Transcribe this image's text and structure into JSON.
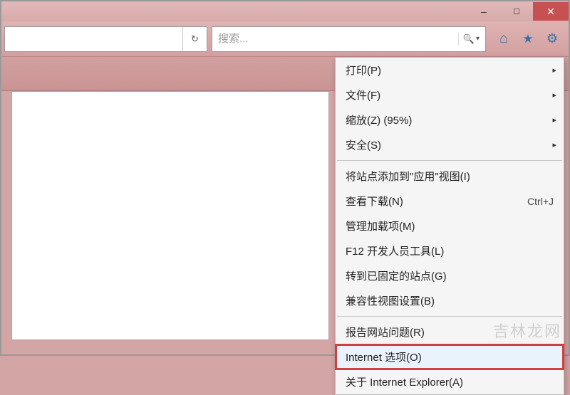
{
  "window": {
    "minimize_tip": "Minimize",
    "maximize_tip": "Restore",
    "close_tip": "Close"
  },
  "toolbar": {
    "search_placeholder": "搜索...",
    "refresh_tip": "Refresh",
    "search_tip": "Search",
    "home_tip": "Home",
    "favorites_tip": "Favorites",
    "tools_tip": "Tools"
  },
  "menu": {
    "print": "打印(P)",
    "file": "文件(F)",
    "zoom": "缩放(Z) (95%)",
    "safety": "安全(S)",
    "add_to_apps": "将站点添加到\"应用\"视图(I)",
    "view_downloads": "查看下载(N)",
    "view_downloads_accel": "Ctrl+J",
    "manage_addons": "管理加载项(M)",
    "f12_devtools": "F12 开发人员工具(L)",
    "goto_pinned": "转到已固定的站点(G)",
    "compat_view": "兼容性视图设置(B)",
    "report_problem": "报告网站问题(R)",
    "internet_options": "Internet 选项(O)",
    "about_ie": "关于 Internet Explorer(A)"
  },
  "watermark": "吉林龙网"
}
